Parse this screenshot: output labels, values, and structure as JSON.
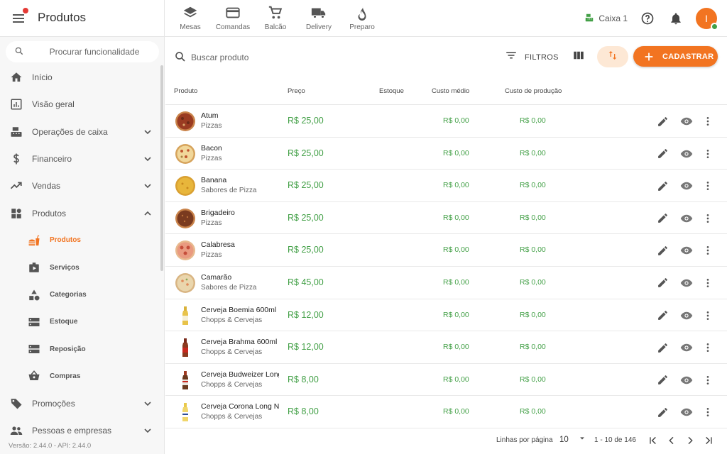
{
  "app": {
    "title": "Produtos",
    "notification_dot_color": "#e53935",
    "accent_color": "#f27421"
  },
  "quicknav": [
    {
      "label": "Mesas",
      "icon": "layers-icon"
    },
    {
      "label": "Comandas",
      "icon": "card-icon"
    },
    {
      "label": "Balcão",
      "icon": "cart-icon"
    },
    {
      "label": "Delivery",
      "icon": "truck-icon"
    },
    {
      "label": "Preparo",
      "icon": "fire-icon"
    }
  ],
  "topright": {
    "caixa_label": "Caixa 1",
    "avatar_initial": "I"
  },
  "sidebar": {
    "search_placeholder": "Procurar funcionalidade",
    "items": [
      {
        "label": "Início",
        "icon": "home-icon"
      },
      {
        "label": "Visão geral",
        "icon": "chart-icon"
      },
      {
        "label": "Operações de caixa",
        "icon": "register-icon"
      },
      {
        "label": "Financeiro",
        "icon": "dollar-icon"
      },
      {
        "label": "Vendas",
        "icon": "trending-icon"
      },
      {
        "label": "Produtos",
        "icon": "dashboard-icon"
      }
    ],
    "subitems": [
      {
        "label": "Produtos",
        "icon": "fastfood-icon",
        "active": true
      },
      {
        "label": "Serviços",
        "icon": "video-icon"
      },
      {
        "label": "Categorias",
        "icon": "shapes-icon"
      },
      {
        "label": "Estoque",
        "icon": "storage-icon"
      },
      {
        "label": "Reposição",
        "icon": "storage-icon"
      },
      {
        "label": "Compras",
        "icon": "basket-icon"
      }
    ],
    "bottom_items": [
      {
        "label": "Promoções",
        "icon": "tag-icon"
      },
      {
        "label": "Pessoas e empresas",
        "icon": "people-icon"
      }
    ],
    "version": "Versão: 2.44.0 - API: 2.44.0"
  },
  "toolbar": {
    "search_placeholder": "Buscar produto",
    "filters_label": "FILTROS",
    "add_label": "CADASTRAR"
  },
  "table": {
    "headers": [
      "Produto",
      "Preço",
      "Estoque",
      "Custo médio",
      "Custo de produção"
    ],
    "rows": [
      {
        "name": "Atum",
        "category": "Pizzas",
        "price": "R$ 25,00",
        "avg_cost": "R$ 0,00",
        "prod_cost": "R$ 0,00",
        "thumb": "pizza-dark"
      },
      {
        "name": "Bacon",
        "category": "Pizzas",
        "price": "R$ 25,00",
        "avg_cost": "R$ 0,00",
        "prod_cost": "R$ 0,00",
        "thumb": "pizza-cheese"
      },
      {
        "name": "Banana",
        "category": "Sabores de Pizza",
        "price": "R$ 25,00",
        "avg_cost": "R$ 0,00",
        "prod_cost": "R$ 0,00",
        "thumb": "pizza-yellow"
      },
      {
        "name": "Brigadeiro",
        "category": "Pizzas",
        "price": "R$ 25,00",
        "avg_cost": "R$ 0,00",
        "prod_cost": "R$ 0,00",
        "thumb": "pizza-chocolate"
      },
      {
        "name": "Calabresa",
        "category": "Pizzas",
        "price": "R$ 25,00",
        "avg_cost": "R$ 0,00",
        "prod_cost": "R$ 0,00",
        "thumb": "pizza-pepperoni"
      },
      {
        "name": "Camarão",
        "category": "Sabores de Pizza",
        "price": "R$ 45,00",
        "avg_cost": "R$ 0,00",
        "prod_cost": "R$ 0,00",
        "thumb": "pizza-light"
      },
      {
        "name": "Cerveja Boemia 600ml",
        "category": "Chopps & Cervejas",
        "price": "R$ 12,00",
        "avg_cost": "R$ 0,00",
        "prod_cost": "R$ 0,00",
        "thumb": "beer-gold"
      },
      {
        "name": "Cerveja Brahma 600ml",
        "category": "Chopps & Cervejas",
        "price": "R$ 12,00",
        "avg_cost": "R$ 0,00",
        "prod_cost": "R$ 0,00",
        "thumb": "beer-red"
      },
      {
        "name": "Cerveja Budweizer Long Neck",
        "category": "Chopps & Cervejas",
        "price": "R$ 8,00",
        "avg_cost": "R$ 0,00",
        "prod_cost": "R$ 0,00",
        "thumb": "beer-brown"
      },
      {
        "name": "Cerveja Corona Long Neck",
        "category": "Chopps & Cervejas",
        "price": "R$ 8,00",
        "avg_cost": "R$ 0,00",
        "prod_cost": "R$ 0,00",
        "thumb": "beer-clear"
      }
    ]
  },
  "pagination": {
    "rows_per_page_label": "Linhas por página",
    "rows_per_page_value": "10",
    "range_label": "1 - 10 de 146"
  }
}
